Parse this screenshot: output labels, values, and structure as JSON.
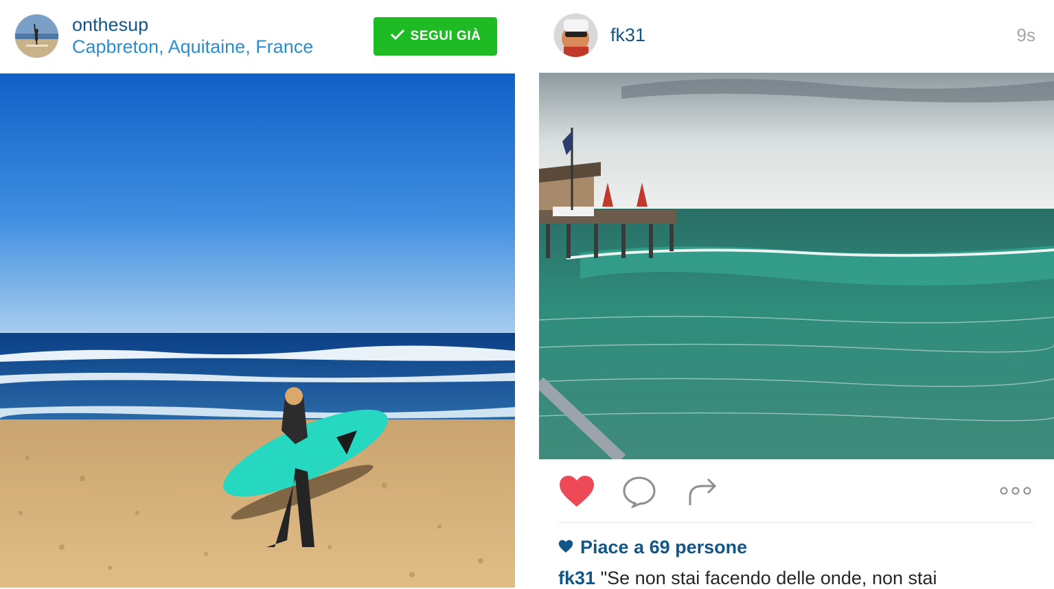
{
  "left_post": {
    "username": "onthesup",
    "location": "Capbreton, Aquitaine, France",
    "follow_button": "SEGUI GIÀ"
  },
  "right_post": {
    "username": "fk31",
    "timestamp": "9s",
    "likes": "Piace a 69 persone",
    "caption_user": "fk31",
    "caption_text": "\"Se non stai facendo delle onde, non stai"
  },
  "colors": {
    "link_blue": "#125688",
    "location_blue": "#2b8ed0",
    "follow_green": "#1fbb24",
    "heart_red": "#ed4956"
  },
  "icons": [
    "check-icon",
    "heart-icon",
    "comment-icon",
    "share-icon",
    "more-icon"
  ]
}
